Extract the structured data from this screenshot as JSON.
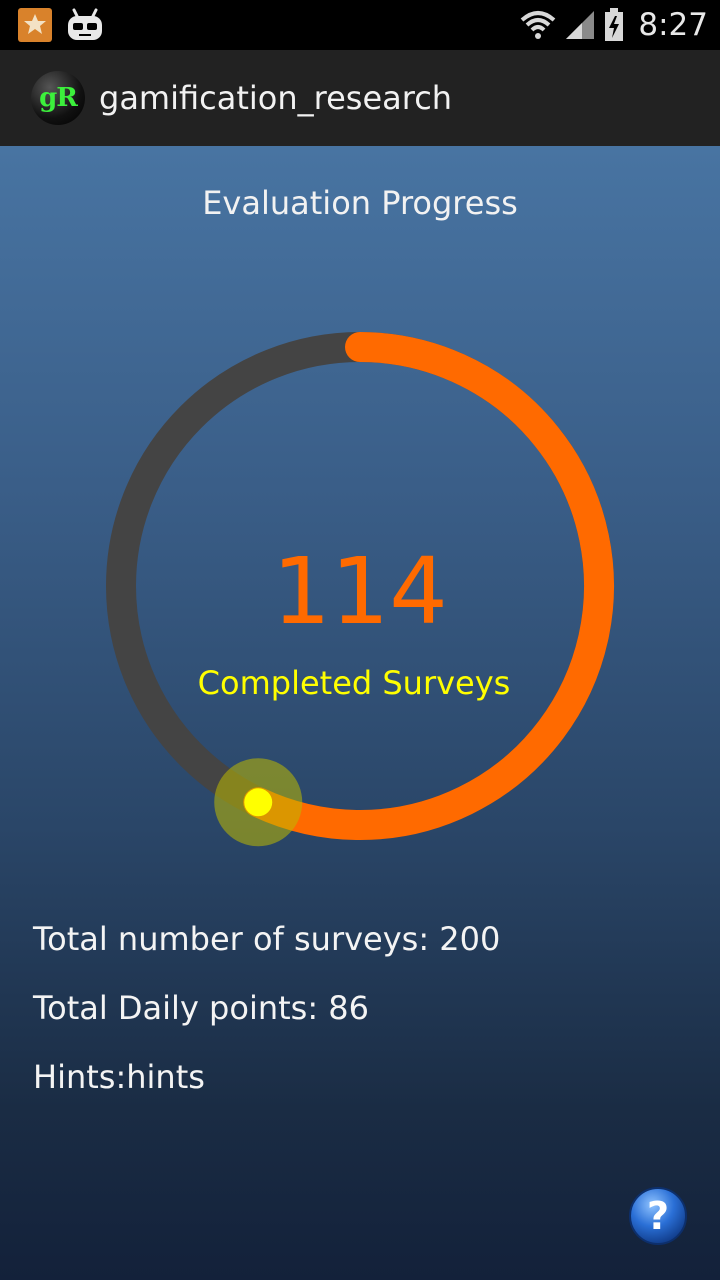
{
  "status_bar": {
    "time": "8:27",
    "icons": [
      "app-notification-icon",
      "cyanogen-droid-icon",
      "wifi-icon",
      "signal-icon",
      "battery-icon"
    ]
  },
  "action_bar": {
    "logo_text": "gR",
    "title": "gamification_research"
  },
  "progress": {
    "heading": "Evaluation Progress",
    "completed_count": "114",
    "completed_label": "Completed Surveys",
    "total_surveys": 200,
    "fraction_complete": 0.57,
    "colors": {
      "track": "#444444",
      "progress": "#ff6a00",
      "thumb": "#ffff00",
      "count_text": "#ff6a00",
      "label_text": "#ffff00"
    }
  },
  "stats": {
    "total_surveys": "Total number of surveys: 200",
    "daily_points": "Total Daily points: 86",
    "hints": "Hints:hints"
  },
  "help": {
    "icon": "help-icon",
    "glyph": "?"
  }
}
